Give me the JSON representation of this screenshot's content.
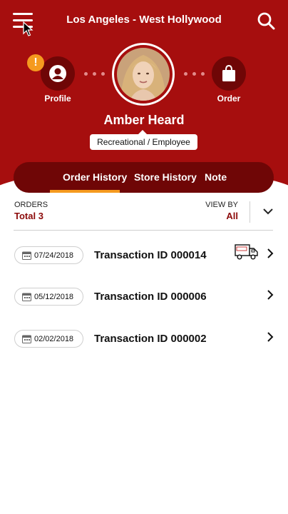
{
  "header": {
    "location_title": "Los Angeles - West Hollywood"
  },
  "profile": {
    "profile_label": "Profile",
    "order_label": "Order",
    "alert_badge": "!",
    "name": "Amber Heard",
    "role": "Recreational / Employee"
  },
  "tabs": [
    {
      "label": "Order History",
      "active": true
    },
    {
      "label": "Store History",
      "active": false
    },
    {
      "label": "Note",
      "active": false
    }
  ],
  "summary": {
    "orders_label": "ORDERS",
    "orders_total": "Total 3",
    "view_by_label": "VIEW BY",
    "view_by_value": "All"
  },
  "orders": [
    {
      "date": "07/24/2018",
      "transaction": "Transaction ID 000014",
      "delivery_icon": "truck-icon"
    },
    {
      "date": "05/12/2018",
      "transaction": "Transaction ID 000006"
    },
    {
      "date": "02/02/2018",
      "transaction": "Transaction ID 000002"
    }
  ],
  "colors": {
    "brand_red": "#a60e0e",
    "dark_red": "#6f0606",
    "accent_orange": "#f59a1f"
  }
}
